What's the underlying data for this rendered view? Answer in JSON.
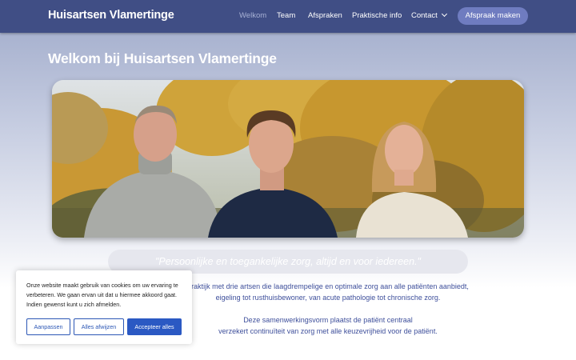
{
  "header": {
    "brand": "Huisartsen Vlamertinge",
    "nav": [
      {
        "label": "Welkom",
        "active": true
      },
      {
        "label": "Team",
        "active": false
      },
      {
        "label": "Afspraken",
        "active": false
      },
      {
        "label": "Praktische info",
        "active": false
      },
      {
        "label": "Contact",
        "active": false
      }
    ],
    "cta_label": "Afspraak maken"
  },
  "main": {
    "title": "Welkom bij Huisartsen Vlamertinge",
    "quote": "\"Persoonlijke en toegankelijke zorg, altijd en voor iedereen.\"",
    "paragraph1_line1": "praktijk met drie artsen die laagdrempelige en optimale zorg aan alle patiënten aanbiedt,",
    "paragraph1_line2": "eigeling tot rusthuisbewoner, van acute pathologie tot chronische zorg.",
    "paragraph2_line1": "Deze samenwerkingsvorm plaatst de patiënt centraal",
    "paragraph2_line2": "verzekert continuïteit van zorg met alle keuzevrijheid voor de patiënt."
  },
  "cookie_banner": {
    "text": "Onze website maakt gebruik van cookies om uw ervaring te verbeteren. We gaan ervan uit dat u hiermee akkoord gaat. Indien gewenst kunt u zich afmelden.",
    "btn_customize": "Aanpassen",
    "btn_reject": "Alles afwijzen",
    "btn_accept": "Accepteer alles"
  },
  "colors": {
    "header_bg": "#404e85",
    "accent": "#6f7cc0",
    "link_blue": "#2b59c3",
    "text_blue": "#3e4f9b"
  }
}
